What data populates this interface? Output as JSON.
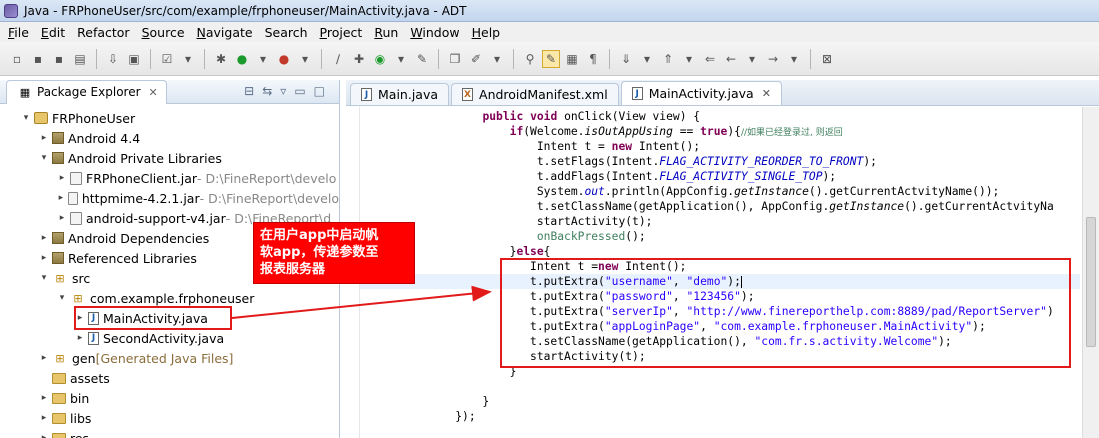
{
  "window": {
    "title": "Java - FRPhoneUser/src/com/example/frphoneuser/MainActivity.java - ADT"
  },
  "menu": [
    {
      "mn": "F",
      "rest": "ile"
    },
    {
      "mn": "E",
      "rest": "dit"
    },
    {
      "mn": "",
      "rest": "Refactor"
    },
    {
      "mn": "S",
      "rest": "ource"
    },
    {
      "mn": "N",
      "rest": "avigate"
    },
    {
      "mn": "",
      "rest": "Search"
    },
    {
      "mn": "P",
      "rest": "roject"
    },
    {
      "mn": "R",
      "rest": "un"
    },
    {
      "mn": "W",
      "rest": "indow"
    },
    {
      "mn": "H",
      "rest": "elp"
    }
  ],
  "explorer": {
    "tab_label": "Package Explorer",
    "tree": [
      {
        "indent": 1,
        "twisty": "▾",
        "icon": "project-icon",
        "label": "FRPhoneUser",
        "muted": ""
      },
      {
        "indent": 2,
        "twisty": "▸",
        "icon": "library-icon",
        "label": "Android 4.4",
        "muted": ""
      },
      {
        "indent": 2,
        "twisty": "▾",
        "icon": "library-icon",
        "label": "Android Private Libraries",
        "muted": ""
      },
      {
        "indent": 3,
        "twisty": "▸",
        "icon": "jar-icon",
        "label": "FRPhoneClient.jar",
        "muted": " - D:\\FineReport\\develo"
      },
      {
        "indent": 3,
        "twisty": "▸",
        "icon": "jar-icon",
        "label": "httpmime-4.2.1.jar",
        "muted": " - D:\\FineReport\\develo"
      },
      {
        "indent": 3,
        "twisty": "▸",
        "icon": "jar-icon",
        "label": "android-support-v4.jar",
        "muted": " - D:\\FineReport\\d"
      },
      {
        "indent": 2,
        "twisty": "▸",
        "icon": "library-icon",
        "label": "Android Dependencies",
        "muted": ""
      },
      {
        "indent": 2,
        "twisty": "▸",
        "icon": "library-icon",
        "label": "Referenced Libraries",
        "muted": ""
      },
      {
        "indent": 2,
        "twisty": "▾",
        "icon": "source-folder-icon",
        "label": "src",
        "muted": ""
      },
      {
        "indent": 3,
        "twisty": "▾",
        "icon": "package-icon",
        "label": "com.example.frphoneuser",
        "muted": ""
      },
      {
        "indent": 4,
        "twisty": "▸",
        "icon": "java-file-icon",
        "label": "MainActivity.java",
        "muted": ""
      },
      {
        "indent": 4,
        "twisty": "▸",
        "icon": "java-file-icon",
        "label": "SecondActivity.java",
        "muted": ""
      },
      {
        "indent": 2,
        "twisty": "▸",
        "icon": "source-folder-icon",
        "label": "gen",
        "muted": "",
        "deco": " [Generated Java Files]"
      },
      {
        "indent": 2,
        "twisty": "",
        "icon": "folder-icon",
        "label": "assets",
        "muted": ""
      },
      {
        "indent": 2,
        "twisty": "▸",
        "icon": "folder-icon",
        "label": "bin",
        "muted": ""
      },
      {
        "indent": 2,
        "twisty": "▸",
        "icon": "folder-icon",
        "label": "libs",
        "muted": ""
      },
      {
        "indent": 2,
        "twisty": "▸",
        "icon": "folder-icon",
        "label": "res",
        "muted": ""
      }
    ]
  },
  "editor": {
    "tabs": [
      {
        "label": "Main.java",
        "kind": "J",
        "active": false,
        "close": ""
      },
      {
        "label": "AndroidManifest.xml",
        "kind": "X",
        "active": false,
        "close": ""
      },
      {
        "label": "MainActivity.java",
        "kind": "J",
        "active": true,
        "close": "✕"
      }
    ]
  },
  "code": [
    [
      [
        "",
        "                  "
      ],
      [
        "kw",
        "public"
      ],
      [
        "",
        " "
      ],
      [
        "kw",
        "void"
      ],
      [
        "",
        " onClick(View view) {"
      ]
    ],
    [
      [
        "",
        "                      "
      ],
      [
        "kw",
        "if"
      ],
      [
        "",
        "(Welcome."
      ],
      [
        "it",
        "isOutAppUsing"
      ],
      [
        "",
        " == "
      ],
      [
        "kw",
        "true"
      ],
      [
        "",
        "){"
      ],
      [
        "cmt",
        "//如果已经登录过, 则返回"
      ]
    ],
    [
      [
        "",
        "                          Intent t = "
      ],
      [
        "kw",
        "new"
      ],
      [
        "",
        " Intent();"
      ]
    ],
    [
      [
        "",
        "                          t.setFlags(Intent."
      ],
      [
        "fld",
        "FLAG_ACTIVITY_REORDER_TO_FRONT"
      ],
      [
        "",
        ");"
      ]
    ],
    [
      [
        "",
        "                          t.addFlags(Intent."
      ],
      [
        "fld",
        "FLAG_ACTIVITY_SINGLE_TOP"
      ],
      [
        "",
        ");"
      ]
    ],
    [
      [
        "",
        "                          System."
      ],
      [
        "fld",
        "out"
      ],
      [
        "",
        ".println(AppConfig."
      ],
      [
        "it",
        "getInstance"
      ],
      [
        "",
        "().getCurrentActvityName());"
      ]
    ],
    [
      [
        "",
        "                          t.setClassName(getApplication(), AppConfig."
      ],
      [
        "it",
        "getInstance"
      ],
      [
        "",
        "().getCurrentActvityNa"
      ]
    ],
    [
      [
        "",
        "                          startActivity(t);"
      ]
    ],
    [
      [
        "",
        "                          "
      ],
      [
        "grn",
        "onBackPressed"
      ],
      [
        "",
        "();"
      ]
    ],
    [
      [
        "",
        "                      }"
      ],
      [
        "kw",
        "else"
      ],
      [
        "",
        "{"
      ]
    ],
    [
      [
        "",
        "                         Intent t ="
      ],
      [
        "kw",
        "new"
      ],
      [
        "",
        " Intent();"
      ]
    ],
    [
      [
        "",
        "                         t.putExtra("
      ],
      [
        "str",
        "\"username\""
      ],
      [
        "",
        ", "
      ],
      [
        "str",
        "\"demo\""
      ],
      [
        "",
        ");"
      ],
      [
        "caret",
        ""
      ]
    ],
    [
      [
        "",
        "                         t.putExtra("
      ],
      [
        "str",
        "\"password\""
      ],
      [
        "",
        ", "
      ],
      [
        "str",
        "\"123456\""
      ],
      [
        "",
        ");"
      ]
    ],
    [
      [
        "",
        "                         t.putExtra("
      ],
      [
        "str",
        "\"serverIp\""
      ],
      [
        "",
        ", "
      ],
      [
        "str",
        "\"http://www.finereporthelp.com:8889/pad/ReportServer\""
      ],
      [
        "",
        ")"
      ]
    ],
    [
      [
        "",
        "                         t.putExtra("
      ],
      [
        "str",
        "\"appLoginPage\""
      ],
      [
        "",
        ", "
      ],
      [
        "str",
        "\"com.example.frphoneuser.MainActivity\""
      ],
      [
        "",
        ");"
      ]
    ],
    [
      [
        "",
        "                         t.setClassName(getApplication(), "
      ],
      [
        "str",
        "\"com.fr.s.activity.Welcome\""
      ],
      [
        "",
        ");"
      ]
    ],
    [
      [
        "",
        "                         startActivity(t);"
      ]
    ],
    [
      [
        "",
        "                      }"
      ]
    ],
    [
      [
        "",
        ""
      ]
    ],
    [
      [
        "",
        "                  }"
      ]
    ],
    [
      [
        "",
        "              });"
      ]
    ]
  ],
  "annotation": {
    "text": "在用户app中启动帆\n软app，传递参数至\n报表服务器"
  },
  "colors": {
    "highlight": "#e21a1a",
    "callout": "#ff0000"
  }
}
